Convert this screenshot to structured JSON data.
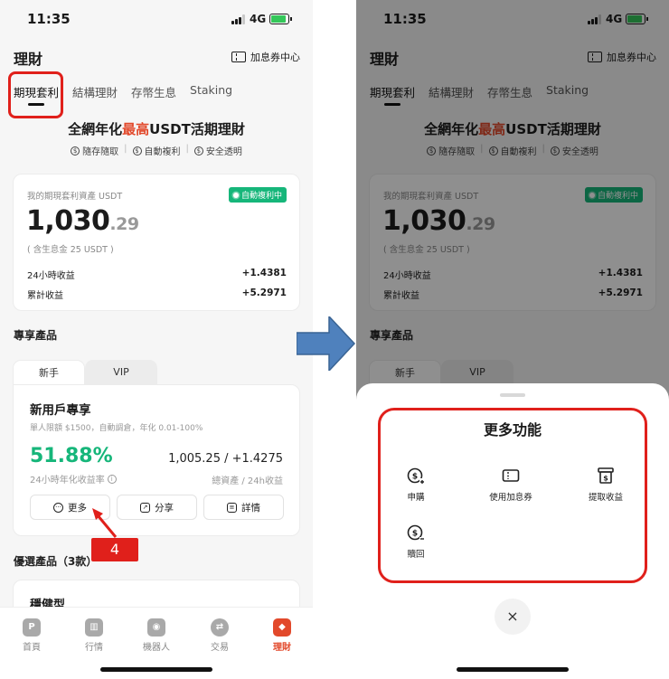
{
  "status": {
    "time": "11:35",
    "network": "4G"
  },
  "header": {
    "title": "理財",
    "coupon_center": "加息券中心"
  },
  "tabs": [
    "期現套利",
    "結構理財",
    "存幣生息",
    "Staking"
  ],
  "hero": {
    "prefix": "全網年化",
    "highlight": "最高",
    "suffix": "USDT活期理財"
  },
  "features": [
    "隨存隨取",
    "自動複利",
    "安全透明"
  ],
  "asset": {
    "label": "我的期現套利資產 USDT",
    "badge": "自動複利中",
    "value_int": "1,030",
    "value_dec": ".29",
    "sub": "( 含生息金 25 USDT )",
    "rows": [
      {
        "label": "24小時收益",
        "value": "+1.4381"
      },
      {
        "label": "累計收益",
        "value": "+5.2971"
      }
    ]
  },
  "exclusive": {
    "title": "專享產品",
    "tabs": [
      "新手",
      "VIP"
    ],
    "product": {
      "name": "新用戶專享",
      "desc": "單人限額 $1500，自動調倉，年化 0.01-100%",
      "rate": "51.88%",
      "rate_label": "24小時年化收益率",
      "assets": "1,005.25 / +1.4275",
      "assets_label": "總資產 / 24h收益",
      "buttons": [
        "更多",
        "分享",
        "詳情"
      ]
    }
  },
  "preferred": {
    "title": "優選產品（3款）",
    "first_name": "穩健型"
  },
  "nav": [
    "首頁",
    "行情",
    "機器人",
    "交易",
    "理財"
  ],
  "annotation": {
    "step": "4"
  },
  "sheet": {
    "title": "更多功能",
    "functions": [
      "申購",
      "使用加息券",
      "提取收益",
      "贖回"
    ],
    "close": "×"
  },
  "colors": {
    "accent": "#e2492b",
    "green": "#16b67a",
    "annotation_red": "#e0201b",
    "arrow_blue": "#4f81bd"
  }
}
